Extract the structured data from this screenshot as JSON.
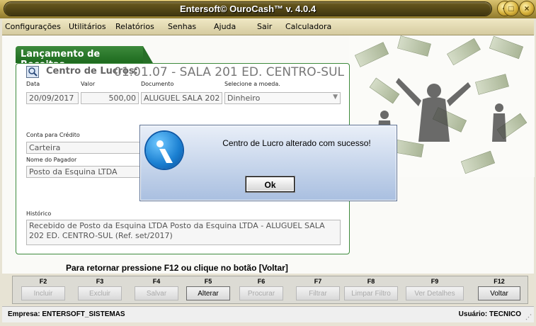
{
  "window": {
    "title": "Entersoft© OuroCash™ v. 4.0.4"
  },
  "menu": [
    {
      "label": "Configurações"
    },
    {
      "label": "Utilitários"
    },
    {
      "label": "Relatórios"
    },
    {
      "label": "Senhas"
    },
    {
      "label": "Ajuda"
    },
    {
      "label": "Sair"
    },
    {
      "label": "Calculadora"
    }
  ],
  "form": {
    "tab_title": "Lançamento de Receitas",
    "centro_label": "Centro de Lucros:",
    "centro_value": "01.01.07 - SALA 201 ED. CENTRO-SUL",
    "data_label": "Data",
    "data_value": "20/09/2017",
    "valor_label": "Valor",
    "valor_value": "500,00",
    "documento_label": "Documento",
    "documento_value": "ALUGUEL SALA 202 ED",
    "moeda_label": "Selecione a moeda.",
    "moeda_value": "Dinheiro",
    "conta_label": "Conta para Crédito",
    "conta_value": "Carteira",
    "pagador_label": "Nome do Pagador",
    "pagador_value": "Posto da Esquina LTDA",
    "historico_label": "Histórico",
    "historico_value": "Recebido de Posto da Esquina LTDA Posto da Esquina LTDA - ALUGUEL SALA 202 ED. CENTRO-SUL (Ref. set/2017)"
  },
  "dialog": {
    "message": "Centro de Lucro alterado com sucesso!",
    "ok_label": "Ok"
  },
  "footer": {
    "help_text": "Para retornar pressione F12 ou clique no botão [Voltar]",
    "fkeys": [
      {
        "key": "F2",
        "label": "Incluir",
        "enabled": false
      },
      {
        "key": "F3",
        "label": "Excluir",
        "enabled": false
      },
      {
        "key": "F4",
        "label": "Salvar",
        "enabled": false
      },
      {
        "key": "F5",
        "label": "Alterar",
        "enabled": true
      },
      {
        "key": "F6",
        "label": "Procurar",
        "enabled": false
      },
      {
        "key": "F7",
        "label": "Filtrar",
        "enabled": false
      },
      {
        "key": "F8",
        "label": "Limpar Filtro",
        "enabled": false
      },
      {
        "key": "F9",
        "label": "Ver Detalhes",
        "enabled": false
      },
      {
        "key": "F12",
        "label": "Voltar",
        "enabled": true
      }
    ],
    "empresa": "Empresa: ENTERSOFT_SISTEMAS",
    "usuario": "Usuário: TECNICO"
  },
  "colors": {
    "accent_green": "#2f7d2f",
    "title_gold": "#b29a45"
  }
}
